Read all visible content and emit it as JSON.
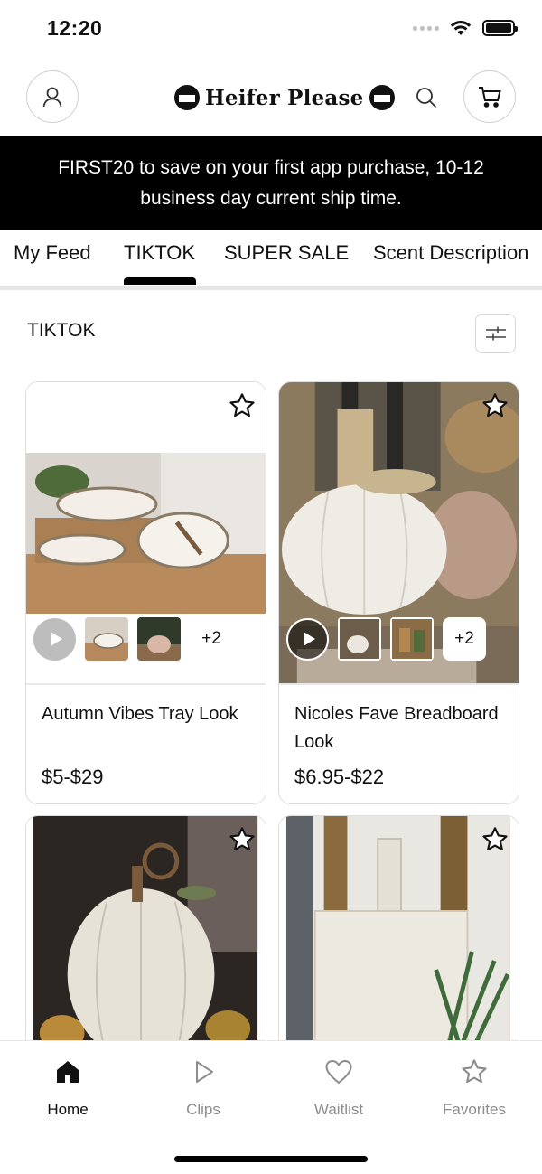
{
  "status_bar": {
    "time": "12:20"
  },
  "header": {
    "logo_text": "Heifer Please",
    "logo_badge_text": "Heifer Please"
  },
  "promo": {
    "text": "FIRST20 to save on your first app purchase, 10-12 business day current ship time."
  },
  "tabs": [
    {
      "label": "My Feed",
      "active": false
    },
    {
      "label": "TIKTOK",
      "active": true
    },
    {
      "label": "SUPER SALE",
      "active": false
    },
    {
      "label": "Scent Description",
      "active": false
    }
  ],
  "section": {
    "title": "TIKTOK"
  },
  "products": [
    {
      "title": "Autumn Vibes Tray Look",
      "price": "$5-$29",
      "more_count": "+2"
    },
    {
      "title": "Nicoles Fave Breadboard Look",
      "price": "$6.95-$22",
      "more_count": "+2"
    }
  ],
  "bottom_nav": [
    {
      "label": "Home",
      "icon": "home-icon",
      "active": true
    },
    {
      "label": "Clips",
      "icon": "play-icon",
      "active": false
    },
    {
      "label": "Waitlist",
      "icon": "heart-icon",
      "active": false
    },
    {
      "label": "Favorites",
      "icon": "star-icon",
      "active": false
    }
  ],
  "colors": {
    "accent": "#000000",
    "inactive_text": "#8d8d8d",
    "border": "#dedede"
  }
}
